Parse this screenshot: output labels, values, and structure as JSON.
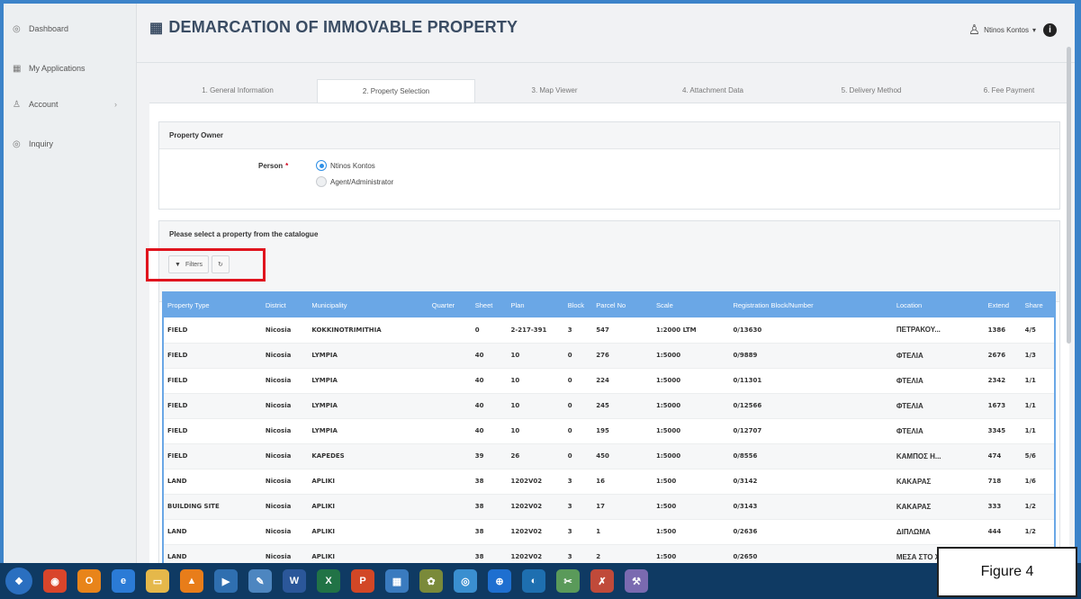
{
  "sidebar": {
    "items": [
      {
        "icon": "◎",
        "label": "Dashboard"
      },
      {
        "icon": "▦",
        "label": "My Applications"
      },
      {
        "icon": "♙",
        "label": "Account",
        "chevron": "›"
      },
      {
        "icon": "◎",
        "label": "Inquiry"
      }
    ]
  },
  "header": {
    "title": "DEMARCATION OF IMMOVABLE PROPERTY",
    "user": "Ntinos Kontos"
  },
  "tabs": [
    "1. General Information",
    "2. Property Selection",
    "3. Map Viewer",
    "4. Attachment Data",
    "5. Delivery Method",
    "6. Fee Payment"
  ],
  "owner": {
    "title": "Property Owner",
    "person_label": "Person",
    "required": "*",
    "options": [
      "Ntinos Kontos",
      "Agent/Administrator"
    ]
  },
  "catalogue": {
    "title": "Please select a property from the catalogue",
    "filters_label": "Filters"
  },
  "table": {
    "headers": [
      "Property Type",
      "District",
      "Municipality",
      "Quarter",
      "Sheet",
      "Plan",
      "Block",
      "Parcel No",
      "Scale",
      "Registration Block/Number",
      "Location",
      "Extend",
      "Share"
    ],
    "rows": [
      [
        "FIELD",
        "Nicosia",
        "KOKKINOTRIMITHIA",
        "",
        "0",
        "2-217-391",
        "3",
        "547",
        "1:2000 LTM",
        "0/13630",
        "ΠΕΤΡΑΚΟΥ...",
        "1386",
        "4/5"
      ],
      [
        "FIELD",
        "Nicosia",
        "LYMPIA",
        "",
        "40",
        "10",
        "0",
        "276",
        "1:5000",
        "0/9889",
        "ΦΤΕΛΙΑ",
        "2676",
        "1/3"
      ],
      [
        "FIELD",
        "Nicosia",
        "LYMPIA",
        "",
        "40",
        "10",
        "0",
        "224",
        "1:5000",
        "0/11301",
        "ΦΤΕΛΙΑ",
        "2342",
        "1/1"
      ],
      [
        "FIELD",
        "Nicosia",
        "LYMPIA",
        "",
        "40",
        "10",
        "0",
        "245",
        "1:5000",
        "0/12566",
        "ΦΤΕΛΙΑ",
        "1673",
        "1/1"
      ],
      [
        "FIELD",
        "Nicosia",
        "LYMPIA",
        "",
        "40",
        "10",
        "0",
        "195",
        "1:5000",
        "0/12707",
        "ΦΤΕΛΙΑ",
        "3345",
        "1/1"
      ],
      [
        "FIELD",
        "Nicosia",
        "KAPEDES",
        "",
        "39",
        "26",
        "0",
        "450",
        "1:5000",
        "0/8556",
        "ΚΑΜΠΟΣ Η...",
        "474",
        "5/6"
      ],
      [
        "LAND",
        "Nicosia",
        "APLIKI",
        "",
        "38",
        "1202V02",
        "3",
        "16",
        "1:500",
        "0/3142",
        "ΚΑΚΑΡΑΣ",
        "718",
        "1/6"
      ],
      [
        "BUILDING SITE",
        "Nicosia",
        "APLIKI",
        "",
        "38",
        "1202V02",
        "3",
        "17",
        "1:500",
        "0/3143",
        "ΚΑΚΑΡΑΣ",
        "333",
        "1/2"
      ],
      [
        "LAND",
        "Nicosia",
        "APLIKI",
        "",
        "38",
        "1202V02",
        "3",
        "1",
        "1:500",
        "0/2636",
        "ΔΙΠΛΩΜΑ",
        "444",
        "1/2"
      ],
      [
        "LAND",
        "Nicosia",
        "APLIKI",
        "",
        "38",
        "1202V02",
        "3",
        "2",
        "1:500",
        "0/2650",
        "ΜΕΣΑ ΣΤΟ Χ",
        "",
        ""
      ]
    ]
  },
  "taskbar": {
    "icons": [
      {
        "name": "start-orb-icon",
        "glyph": "❖",
        "color": "#2a6fc0"
      },
      {
        "name": "chrome-icon",
        "glyph": "◉",
        "color": "#d9452b"
      },
      {
        "name": "outlook-icon",
        "glyph": "O",
        "color": "#e8841a"
      },
      {
        "name": "ie-icon",
        "glyph": "e",
        "color": "#2b7bd6"
      },
      {
        "name": "folder-icon",
        "glyph": "▭",
        "color": "#e5b84a"
      },
      {
        "name": "vlc-icon",
        "glyph": "▲",
        "color": "#e87d1a"
      },
      {
        "name": "media-icon",
        "glyph": "▶",
        "color": "#2f6fb0"
      },
      {
        "name": "paint-icon",
        "glyph": "✎",
        "color": "#4d86c0"
      },
      {
        "name": "word-icon",
        "glyph": "W",
        "color": "#2b579a"
      },
      {
        "name": "excel-icon",
        "glyph": "X",
        "color": "#217346"
      },
      {
        "name": "powerpoint-icon",
        "glyph": "P",
        "color": "#d24726"
      },
      {
        "name": "calculator-icon",
        "glyph": "▦",
        "color": "#3a7bbf"
      },
      {
        "name": "gimp-icon",
        "glyph": "✿",
        "color": "#7a8a3a"
      },
      {
        "name": "search-app-icon",
        "glyph": "◎",
        "color": "#3a8fd0"
      },
      {
        "name": "teamviewer-icon",
        "glyph": "⊕",
        "color": "#1e6fd0"
      },
      {
        "name": "globe-icon",
        "glyph": "◐",
        "color": "#1e6fb0"
      },
      {
        "name": "snipping-icon",
        "glyph": "✂",
        "color": "#5a9a5a"
      },
      {
        "name": "tool-icon",
        "glyph": "✗",
        "color": "#c04a3a"
      },
      {
        "name": "brush-icon",
        "glyph": "⚒",
        "color": "#7a6ab0"
      }
    ]
  },
  "figure_label": "Figure 4"
}
